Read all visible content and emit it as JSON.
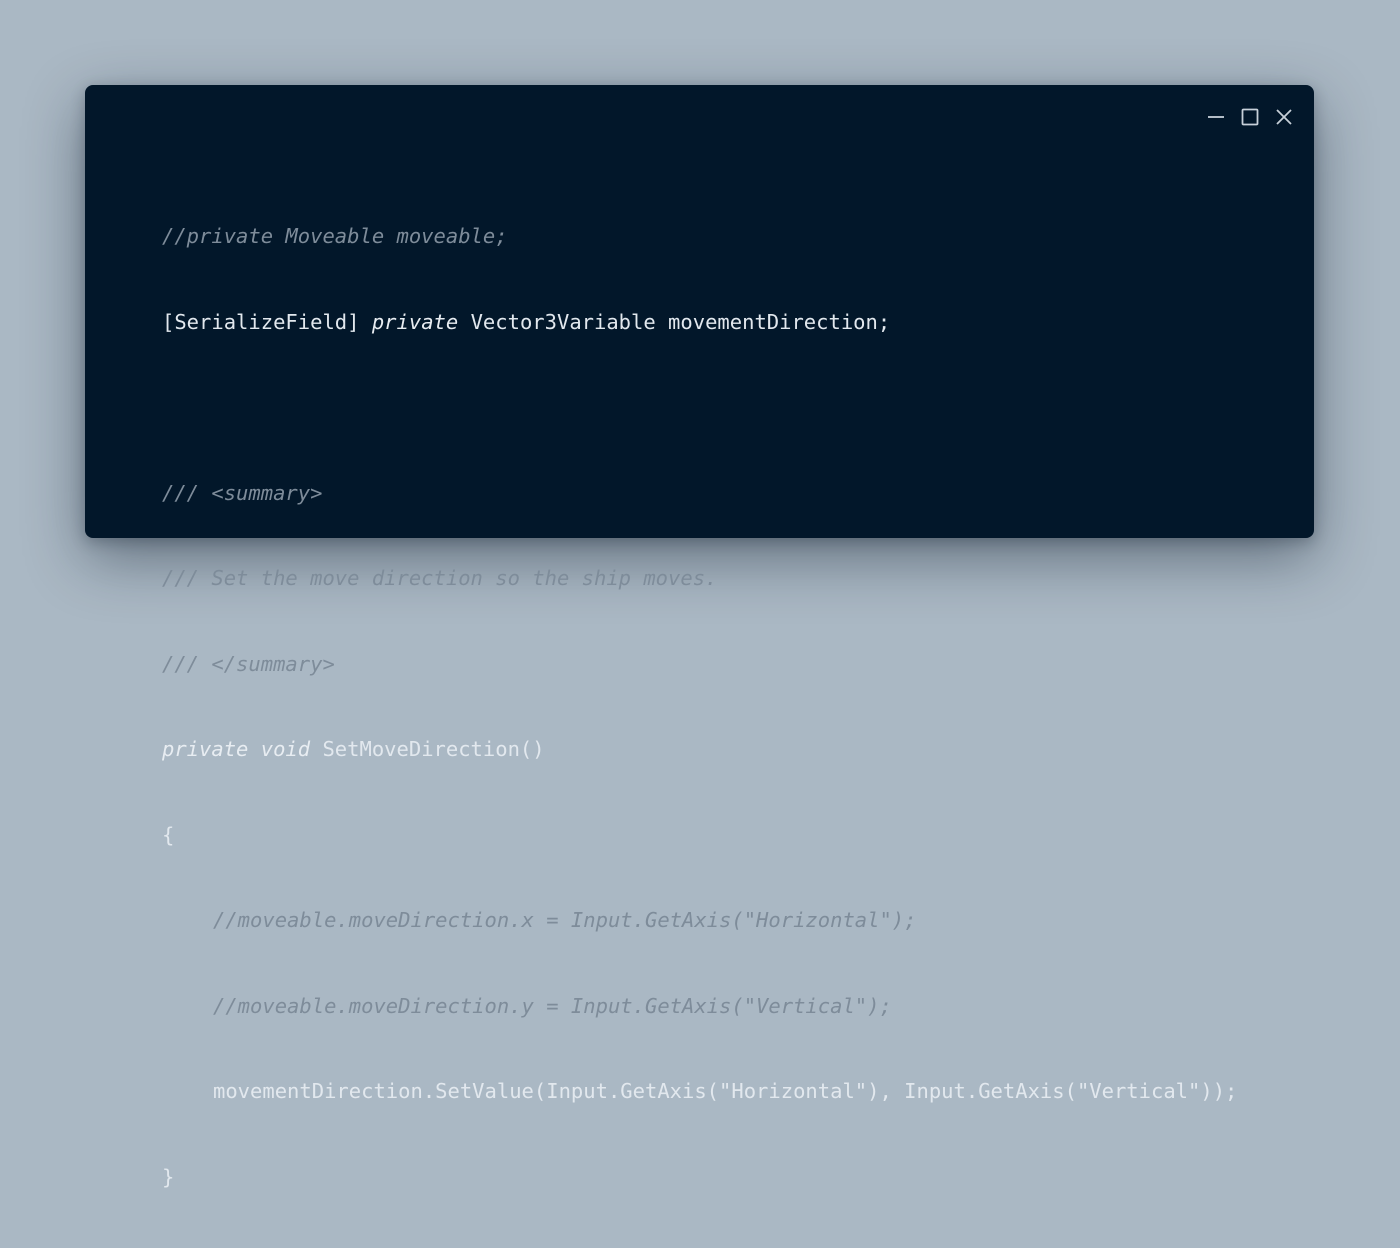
{
  "window": {
    "background": "#02172a",
    "controls": {
      "minimize_icon": "minimize-icon",
      "maximize_icon": "maximize-icon",
      "close_icon": "close-icon"
    }
  },
  "code": {
    "line1": "//private Moveable moveable;",
    "line2_a": "[SerializeField] ",
    "line2_kw": "private",
    "line2_b": " Vector3Variable movementDirection;",
    "line4": "/// <summary>",
    "line5": "/// Set the move direction so the ship moves.",
    "line6": "/// </summary>",
    "line7_kw": "private void",
    "line7_b": " SetMoveDirection()",
    "line8": "{",
    "line9": "//moveable.moveDirection.x = Input.GetAxis(\"Horizontal\");",
    "line10": "//moveable.moveDirection.y = Input.GetAxis(\"Vertical\");",
    "line11": "movementDirection.SetValue(Input.GetAxis(\"Horizontal\"), Input.GetAxis(\"Vertical\"));",
    "line12": "}"
  }
}
